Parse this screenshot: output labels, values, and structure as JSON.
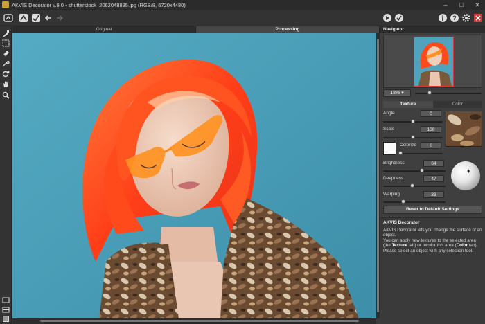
{
  "window": {
    "title": "AKVIS Decorator v.9.0 - shutterstock_2062048895.jpg (RGB/8, 6720x4480)",
    "minimize": "–",
    "maximize": "□",
    "close": "✕"
  },
  "canvas_tabs": {
    "original": "Original",
    "processing": "Processing"
  },
  "navigator": {
    "header": "Navigator",
    "zoom": "18% ▾",
    "zoom_level": 0.18
  },
  "settings": {
    "tab_texture": "Texture",
    "tab_color": "Color",
    "angle_label": "Angle",
    "angle_value": "0",
    "scale_label": "Scale",
    "scale_value": "100",
    "colorize_label": "Colorize",
    "colorize_value": "0",
    "brightness_label": "Brightness",
    "brightness_value": "64",
    "deepness_label": "Deepness",
    "deepness_value": "47",
    "warping_label": "Warping",
    "warping_value": "33",
    "reset_label": "Reset to Default Settings"
  },
  "help": {
    "title": "AKVIS Decorator",
    "p1": "AKVIS Decorator lets you change the surface of an object.",
    "p2_a": "You can apply new textures to the selected area (the ",
    "p2_b": "Texture",
    "p2_c": " tab) or recolor this area (",
    "p2_d": "Color",
    "p2_e": " tab).",
    "p3": "Please select an object with any selection tool."
  },
  "colors": {
    "background": "#4fa3bc",
    "hair": "#ff4a1c",
    "glasses": "#ff8c1a",
    "accent_red": "#d23c3c"
  }
}
